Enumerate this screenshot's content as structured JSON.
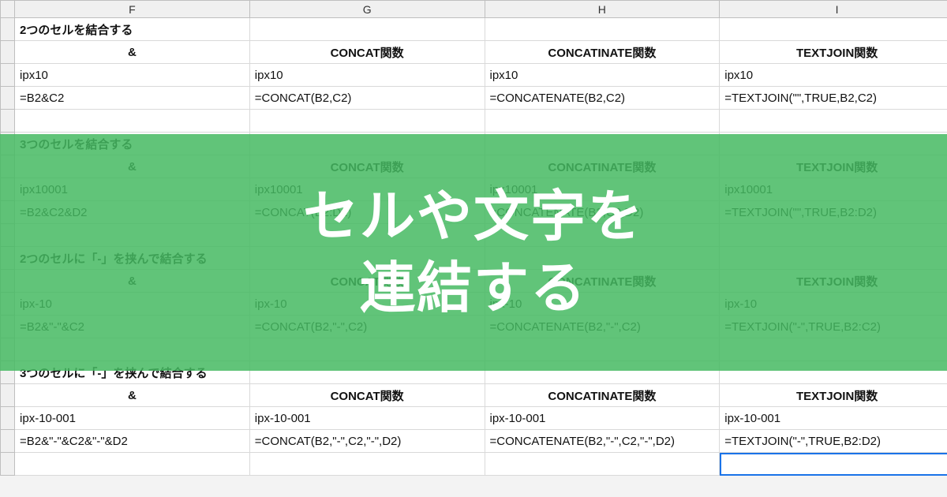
{
  "columns": [
    "F",
    "G",
    "H",
    "I"
  ],
  "overlay": {
    "line1": "セルや文字を",
    "line2": "連結する"
  },
  "sections": [
    {
      "title": "2つのセルを結合する",
      "headers": [
        "&",
        "CONCAT関数",
        "CONCATINATE関数",
        "TEXTJOIN関数"
      ],
      "values": [
        "ipx10",
        "ipx10",
        "ipx10",
        "ipx10"
      ],
      "formulas": [
        "=B2&C2",
        "=CONCAT(B2,C2)",
        "=CONCATENATE(B2,C2)",
        "=TEXTJOIN(\"\",TRUE,B2,C2)"
      ]
    },
    {
      "title": "3つのセルを結合する",
      "headers": [
        "&",
        "CONCAT関数",
        "CONCATINATE関数",
        "TEXTJOIN関数"
      ],
      "values": [
        "ipx10001",
        "ipx10001",
        "ipx10001",
        "ipx10001"
      ],
      "formulas": [
        "=B2&C2&D2",
        "=CONCAT(B2:D2)",
        "=CONCATENATE(B2,C2,D2)",
        "=TEXTJOIN(\"\",TRUE,B2:D2)"
      ]
    },
    {
      "title": "2つのセルに「-」を挟んで結合する",
      "headers": [
        "&",
        "CONCAT関数",
        "CONCATINATE関数",
        "TEXTJOIN関数"
      ],
      "values": [
        "ipx-10",
        "ipx-10",
        "ipx-10",
        "ipx-10"
      ],
      "formulas": [
        "=B2&\"-\"&C2",
        "=CONCAT(B2,\"-\",C2)",
        "=CONCATENATE(B2,\"-\",C2)",
        "=TEXTJOIN(\"-\",TRUE,B2:C2)"
      ]
    },
    {
      "title": "3つのセルに「-」を挟んで結合する",
      "headers": [
        "&",
        "CONCAT関数",
        "CONCATINATE関数",
        "TEXTJOIN関数"
      ],
      "values": [
        "ipx-10-001",
        "ipx-10-001",
        "ipx-10-001",
        "ipx-10-001"
      ],
      "formulas": [
        "=B2&\"-\"&C2&\"-\"&D2",
        "=CONCAT(B2,\"-\",C2,\"-\",D2)",
        "=CONCATENATE(B2,\"-\",C2,\"-\",D2)",
        "=TEXTJOIN(\"-\",TRUE,B2:D2)"
      ]
    }
  ]
}
